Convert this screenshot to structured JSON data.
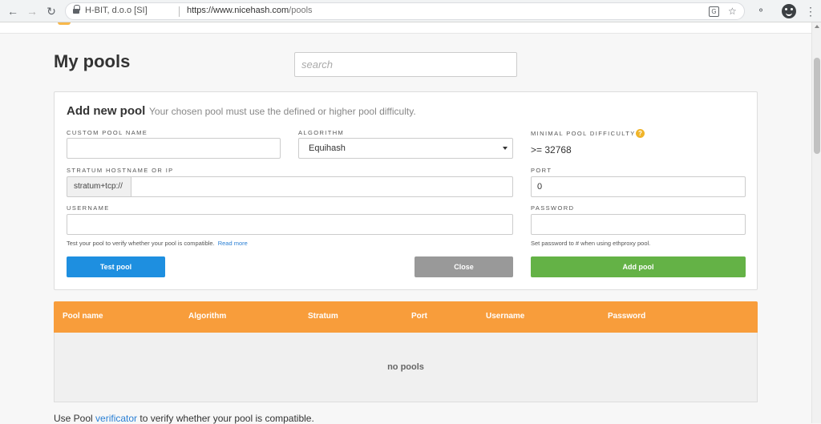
{
  "browser": {
    "site_identity": "H-BIT, d.o.o [SI]",
    "url_host": "https://www.nicehash.com",
    "url_path": "/pools"
  },
  "page": {
    "title": "My pools",
    "search_placeholder": "search"
  },
  "form": {
    "title": "Add new pool",
    "subtitle": "Your chosen pool must use the defined or higher pool difficulty.",
    "custom_pool_name_label": "CUSTOM POOL NAME",
    "custom_pool_name_value": "",
    "algorithm_label": "ALGORITHM",
    "algorithm_value": "Equihash",
    "min_difficulty_label": "MINIMAL POOL DIFFICULTY",
    "min_difficulty_value": ">= 32768",
    "stratum_label": "STRATUM HOSTNAME OR IP",
    "stratum_prefix": "stratum+tcp://",
    "stratum_value": "",
    "port_label": "PORT",
    "port_value": "0",
    "username_label": "USERNAME",
    "username_value": "",
    "password_label": "PASSWORD",
    "password_value": "",
    "test_hint": "Test your pool to verify whether your pool is compatible.",
    "test_hint_link": "Read more",
    "password_hint": "Set password to # when using ethproxy pool.",
    "test_button": "Test pool",
    "close_button": "Close",
    "add_button": "Add pool"
  },
  "table": {
    "columns": [
      "Pool name",
      "Algorithm",
      "Stratum",
      "Port",
      "Username",
      "Password"
    ],
    "empty_text": "no pools"
  },
  "footer": {
    "prefix": "Use Pool ",
    "link": "verificator",
    "suffix": " to verify whether your pool is compatible."
  },
  "colors": {
    "table_header": "#f89d3b",
    "test_button": "#1e8fe0",
    "close_button": "#999999",
    "add_button": "#64b246"
  }
}
